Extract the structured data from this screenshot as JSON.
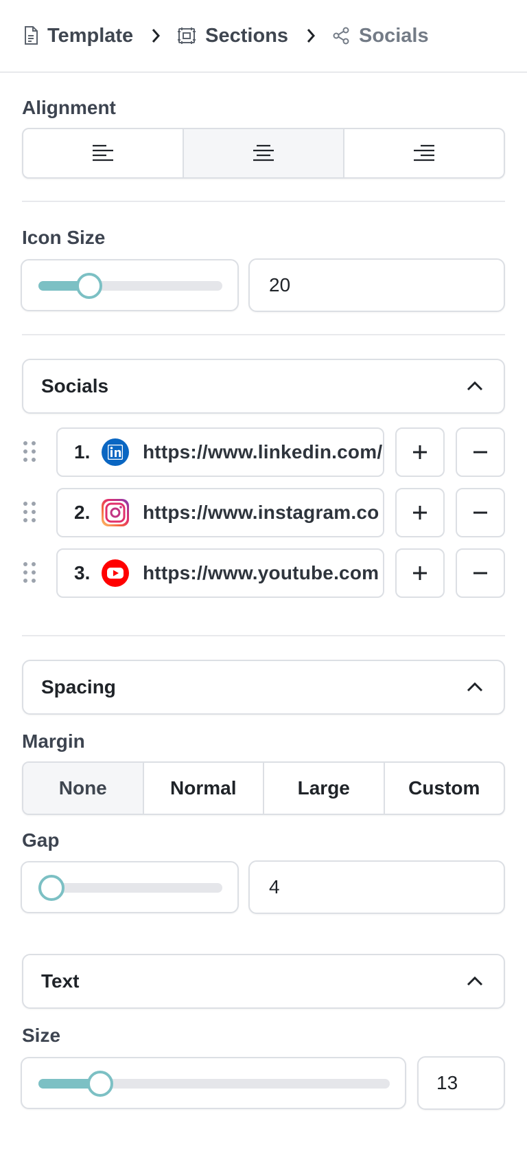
{
  "breadcrumb": {
    "items": [
      {
        "label": "Template",
        "icon": "document-icon"
      },
      {
        "label": "Sections",
        "icon": "frame-icon"
      },
      {
        "label": "Socials",
        "icon": "share-icon"
      }
    ]
  },
  "alignment": {
    "label": "Alignment",
    "options": [
      "align-left",
      "align-center",
      "align-right"
    ],
    "selected": "align-center"
  },
  "icon_size": {
    "label": "Icon Size",
    "value": "20",
    "slider_fraction": 0.24
  },
  "socials": {
    "title": "Socials",
    "items": [
      {
        "index": "1.",
        "network": "linkedin",
        "url": "https://www.linkedin.com/"
      },
      {
        "index": "2.",
        "network": "instagram",
        "url": "https://www.instagram.co"
      },
      {
        "index": "3.",
        "network": "youtube",
        "url": "https://www.youtube.com"
      }
    ]
  },
  "spacing": {
    "title": "Spacing",
    "margin_label": "Margin",
    "margin_options": [
      "None",
      "Normal",
      "Large",
      "Custom"
    ],
    "margin_selected": "None",
    "gap_label": "Gap",
    "gap_value": "4",
    "gap_fraction": 0.0
  },
  "text": {
    "title": "Text",
    "size_label": "Size",
    "size_value": "13",
    "size_fraction": 0.15
  },
  "colors": {
    "accent": "#7cc0c4",
    "linkedin": "#0a66c2",
    "youtube": "#ff0000"
  }
}
